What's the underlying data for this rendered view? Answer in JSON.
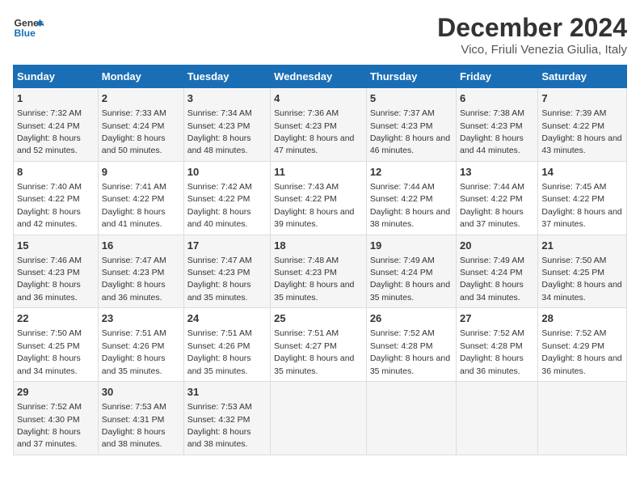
{
  "header": {
    "logo_line1": "General",
    "logo_line2": "Blue",
    "title": "December 2024",
    "subtitle": "Vico, Friuli Venezia Giulia, Italy"
  },
  "days_of_week": [
    "Sunday",
    "Monday",
    "Tuesday",
    "Wednesday",
    "Thursday",
    "Friday",
    "Saturday"
  ],
  "weeks": [
    [
      {
        "day": "1",
        "sunrise": "7:32 AM",
        "sunset": "4:24 PM",
        "daylight": "8 hours and 52 minutes."
      },
      {
        "day": "2",
        "sunrise": "7:33 AM",
        "sunset": "4:24 PM",
        "daylight": "8 hours and 50 minutes."
      },
      {
        "day": "3",
        "sunrise": "7:34 AM",
        "sunset": "4:23 PM",
        "daylight": "8 hours and 48 minutes."
      },
      {
        "day": "4",
        "sunrise": "7:36 AM",
        "sunset": "4:23 PM",
        "daylight": "8 hours and 47 minutes."
      },
      {
        "day": "5",
        "sunrise": "7:37 AM",
        "sunset": "4:23 PM",
        "daylight": "8 hours and 46 minutes."
      },
      {
        "day": "6",
        "sunrise": "7:38 AM",
        "sunset": "4:23 PM",
        "daylight": "8 hours and 44 minutes."
      },
      {
        "day": "7",
        "sunrise": "7:39 AM",
        "sunset": "4:22 PM",
        "daylight": "8 hours and 43 minutes."
      }
    ],
    [
      {
        "day": "8",
        "sunrise": "7:40 AM",
        "sunset": "4:22 PM",
        "daylight": "8 hours and 42 minutes."
      },
      {
        "day": "9",
        "sunrise": "7:41 AM",
        "sunset": "4:22 PM",
        "daylight": "8 hours and 41 minutes."
      },
      {
        "day": "10",
        "sunrise": "7:42 AM",
        "sunset": "4:22 PM",
        "daylight": "8 hours and 40 minutes."
      },
      {
        "day": "11",
        "sunrise": "7:43 AM",
        "sunset": "4:22 PM",
        "daylight": "8 hours and 39 minutes."
      },
      {
        "day": "12",
        "sunrise": "7:44 AM",
        "sunset": "4:22 PM",
        "daylight": "8 hours and 38 minutes."
      },
      {
        "day": "13",
        "sunrise": "7:44 AM",
        "sunset": "4:22 PM",
        "daylight": "8 hours and 37 minutes."
      },
      {
        "day": "14",
        "sunrise": "7:45 AM",
        "sunset": "4:22 PM",
        "daylight": "8 hours and 37 minutes."
      }
    ],
    [
      {
        "day": "15",
        "sunrise": "7:46 AM",
        "sunset": "4:23 PM",
        "daylight": "8 hours and 36 minutes."
      },
      {
        "day": "16",
        "sunrise": "7:47 AM",
        "sunset": "4:23 PM",
        "daylight": "8 hours and 36 minutes."
      },
      {
        "day": "17",
        "sunrise": "7:47 AM",
        "sunset": "4:23 PM",
        "daylight": "8 hours and 35 minutes."
      },
      {
        "day": "18",
        "sunrise": "7:48 AM",
        "sunset": "4:23 PM",
        "daylight": "8 hours and 35 minutes."
      },
      {
        "day": "19",
        "sunrise": "7:49 AM",
        "sunset": "4:24 PM",
        "daylight": "8 hours and 35 minutes."
      },
      {
        "day": "20",
        "sunrise": "7:49 AM",
        "sunset": "4:24 PM",
        "daylight": "8 hours and 34 minutes."
      },
      {
        "day": "21",
        "sunrise": "7:50 AM",
        "sunset": "4:25 PM",
        "daylight": "8 hours and 34 minutes."
      }
    ],
    [
      {
        "day": "22",
        "sunrise": "7:50 AM",
        "sunset": "4:25 PM",
        "daylight": "8 hours and 34 minutes."
      },
      {
        "day": "23",
        "sunrise": "7:51 AM",
        "sunset": "4:26 PM",
        "daylight": "8 hours and 35 minutes."
      },
      {
        "day": "24",
        "sunrise": "7:51 AM",
        "sunset": "4:26 PM",
        "daylight": "8 hours and 35 minutes."
      },
      {
        "day": "25",
        "sunrise": "7:51 AM",
        "sunset": "4:27 PM",
        "daylight": "8 hours and 35 minutes."
      },
      {
        "day": "26",
        "sunrise": "7:52 AM",
        "sunset": "4:28 PM",
        "daylight": "8 hours and 35 minutes."
      },
      {
        "day": "27",
        "sunrise": "7:52 AM",
        "sunset": "4:28 PM",
        "daylight": "8 hours and 36 minutes."
      },
      {
        "day": "28",
        "sunrise": "7:52 AM",
        "sunset": "4:29 PM",
        "daylight": "8 hours and 36 minutes."
      }
    ],
    [
      {
        "day": "29",
        "sunrise": "7:52 AM",
        "sunset": "4:30 PM",
        "daylight": "8 hours and 37 minutes."
      },
      {
        "day": "30",
        "sunrise": "7:53 AM",
        "sunset": "4:31 PM",
        "daylight": "8 hours and 38 minutes."
      },
      {
        "day": "31",
        "sunrise": "7:53 AM",
        "sunset": "4:32 PM",
        "daylight": "8 hours and 38 minutes."
      },
      null,
      null,
      null,
      null
    ]
  ]
}
